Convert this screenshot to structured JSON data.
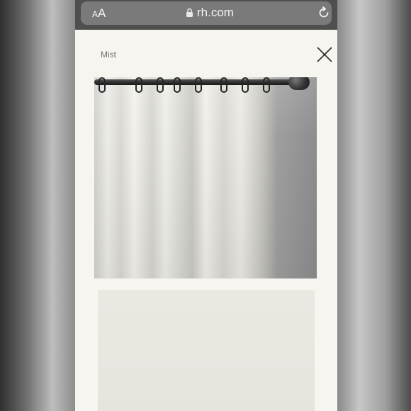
{
  "browser": {
    "aa_small": "A",
    "aa_large": "A",
    "domain": "rh.com",
    "icons": {
      "lock": "lock-icon",
      "reload": "reload-icon"
    }
  },
  "modal": {
    "swatch_name": "Mist",
    "close_icon": "close-icon"
  },
  "colors": {
    "url_bar_bg": "#7a7a7a",
    "page_bg": "#f7f5f0",
    "swatch_fabric": "#ebe8e2"
  }
}
